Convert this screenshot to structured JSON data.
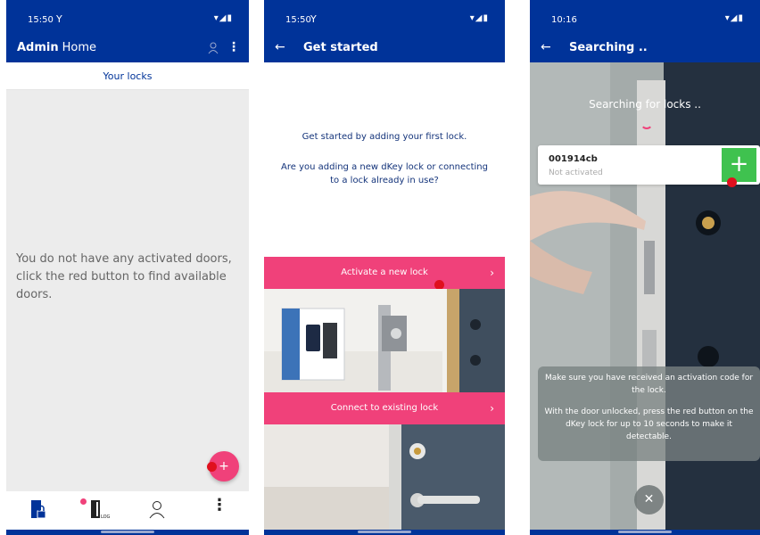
{
  "screen1": {
    "status": {
      "time": "15:50",
      "carrier_icon": "antenna-icon",
      "icons": "▾◢▮"
    },
    "appbar": {
      "title_bold": "Admin",
      "title": "Home"
    },
    "tab_header": "Your locks",
    "empty_message": "You do not have any activated doors, click the red button to find available doors.",
    "fab_label": "+",
    "bottom_nav": {
      "log_label": "LOG"
    }
  },
  "screen2": {
    "status": {
      "time": "15:50",
      "icons": "▾◢▮"
    },
    "appbar": {
      "title": "Get started"
    },
    "intro": "Get started by adding your first lock.",
    "question": "Are you adding a new dKey lock or connecting to a lock already in use?",
    "activate_label": "Activate a new lock",
    "connect_label": "Connect to existing lock"
  },
  "screen3": {
    "status": {
      "time": "10:16",
      "icons": "▾◢▮"
    },
    "appbar": {
      "title": "Searching .."
    },
    "searching_text": "Searching for locks ..",
    "lock": {
      "id": "001914cb",
      "status": "Not activated"
    },
    "add_label": "+",
    "info_1": "Make sure you have received an activation code for the lock.",
    "info_2": "With the door unlocked, press the red button on the dKey lock for up to 10 seconds to make it detectable.",
    "close_label": "✕"
  },
  "colors": {
    "brand_blue": "#003399",
    "pink": "#f0417a",
    "green": "#3fc24f",
    "red_dot": "#e0101e"
  }
}
